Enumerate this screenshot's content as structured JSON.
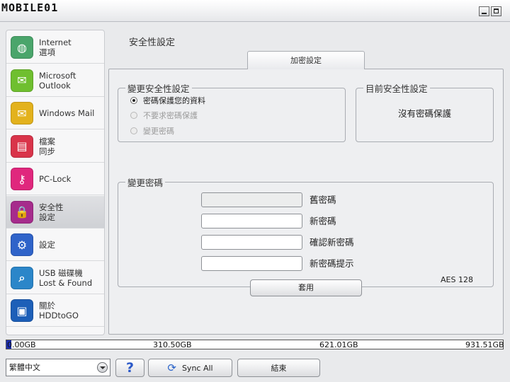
{
  "window": {
    "logo_text": "MOBILE01"
  },
  "sidebar": {
    "items": [
      {
        "line1": "Internet",
        "line2": "選項",
        "icon": "globe-icon",
        "color": "#4aa56b",
        "active": false
      },
      {
        "line1": "Microsoft",
        "line2": "Outlook",
        "icon": "outlook-icon",
        "color": "#6fbf2f",
        "active": false
      },
      {
        "line1": "Windows Mail",
        "line2": "",
        "icon": "mail-icon",
        "color": "#e3b21d",
        "active": false
      },
      {
        "line1": "檔案",
        "line2": "同步",
        "icon": "file-sync-icon",
        "color": "#d9344a",
        "active": false
      },
      {
        "line1": "PC-Lock",
        "line2": "",
        "icon": "key-icon",
        "color": "#e0277d",
        "active": false
      },
      {
        "line1": "安全性",
        "line2": "設定",
        "icon": "lock-icon",
        "color": "#a62c8c",
        "active": true
      },
      {
        "line1": "設定",
        "line2": "",
        "icon": "gear-icon",
        "color": "#2f63c9",
        "active": false
      },
      {
        "line1": "USB 磁碟機",
        "line2": "Lost & Found",
        "icon": "magnifier-icon",
        "color": "#2b86c9",
        "active": false
      },
      {
        "line1": "關於",
        "line2": "HDDtoGO",
        "icon": "briefcase-icon",
        "color": "#1d5fb8",
        "active": false
      }
    ]
  },
  "main": {
    "section_title": "安全性設定",
    "tab_label": "加密設定",
    "change_security": {
      "legend": "變更安全性設定",
      "options": [
        {
          "label": "密碼保護您的資料",
          "checked": true,
          "disabled": false
        },
        {
          "label": "不要求密碼保護",
          "checked": false,
          "disabled": true
        },
        {
          "label": "變更密碼",
          "checked": false,
          "disabled": true
        }
      ]
    },
    "current_security": {
      "legend": "目前安全性設定",
      "status": "沒有密碼保護"
    },
    "change_password": {
      "legend": "變更密碼",
      "fields": [
        {
          "label": "舊密碼",
          "value": "",
          "disabled": true
        },
        {
          "label": "新密碼",
          "value": "",
          "disabled": false
        },
        {
          "label": "確認新密碼",
          "value": "",
          "disabled": false
        },
        {
          "label": "新密碼提示",
          "value": "",
          "disabled": false
        }
      ],
      "encryption": "AES 128",
      "apply_label": "套用"
    }
  },
  "capacity": {
    "labels": [
      "0.00GB",
      "310.50GB",
      "621.01GB",
      "931.51GB"
    ],
    "used_fraction": 0.01,
    "bar_color": "#1c2fb3"
  },
  "footer": {
    "language": "繁體中文",
    "help_label": "?",
    "sync_label": "Sync All",
    "exit_label": "結束"
  }
}
